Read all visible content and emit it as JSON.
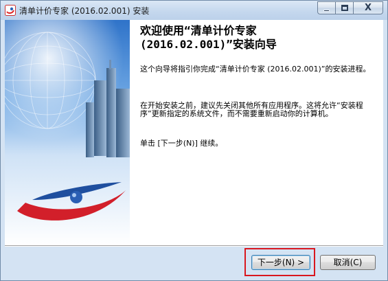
{
  "window": {
    "title": "清单计价专家 (2016.02.001) 安装",
    "close_glyph": "X"
  },
  "welcome": {
    "heading_line1": "欢迎使用“清单计价专家",
    "heading_line2": "(2016.02.001)”安装向导",
    "para1": "这个向导将指引你完成“清单计价专家 (2016.02.001)”的安装进程。",
    "para2": "在开始安装之前，建议先关闭其他所有应用程序。这将允许“安装程序”更新指定的系统文件，而不需要重新启动你的计算机。",
    "para3": "单击 [下一步(N)] 继续。"
  },
  "buttons": {
    "next_label": "下一步(N) >",
    "cancel_label": "取消(C)"
  },
  "colors": {
    "highlight": "#d9161e",
    "titlebar": "#c5d8ee"
  }
}
